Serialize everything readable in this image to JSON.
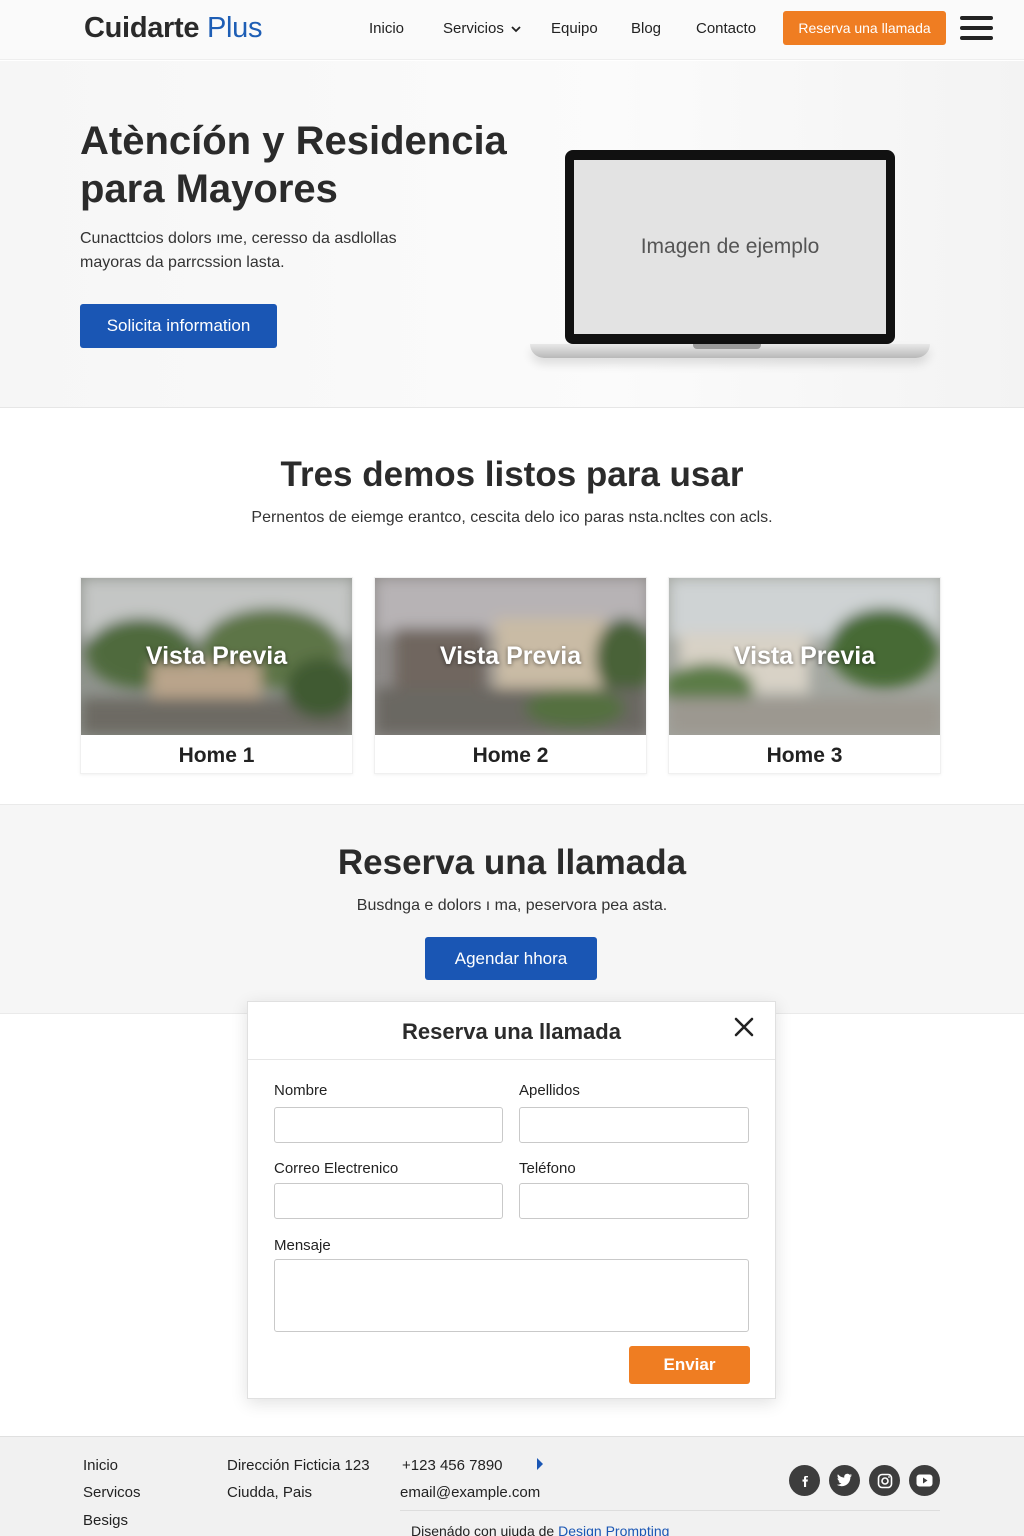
{
  "nav": {
    "logo_main": "Cuidarte",
    "logo_accent": "Plus",
    "links": [
      "Inicio",
      "Servicios",
      "Equipo",
      "Blog",
      "Contacto"
    ],
    "cta": "Reserva una llamada"
  },
  "hero": {
    "title": "Atèncíón y Residencia para Mayores",
    "description": "Cunacttcios dolors ıme, ceresso da asdlollas mayoras da parrcssion lasta.",
    "button": "Solicita information",
    "image_placeholder": "Imagen de ejemplo"
  },
  "demos": {
    "title": "Tres demos listos para usar",
    "subtitle": "Pernentos de eiemge erantco, cescita delo ico paras nsta.ncltes con acls.",
    "cards": [
      {
        "preview": "Vista Previa",
        "name": "Home 1"
      },
      {
        "preview": "Vista Previa",
        "name": "Home 2"
      },
      {
        "preview": "Vista Previa",
        "name": "Home 3"
      }
    ]
  },
  "cta": {
    "title": "Reserva una llamada",
    "subtitle": "Busdnga e dolors ı ma, peservora pea asta.",
    "button": "Agendar hhora"
  },
  "modal": {
    "title": "Reserva una llamada",
    "fields": {
      "first_name": {
        "label": "Nombre",
        "value": ""
      },
      "last_name": {
        "label": "Apellidos",
        "value": ""
      },
      "email": {
        "label": "Correo Electrenico",
        "value": ""
      },
      "phone": {
        "label": "Teléfono",
        "value": ""
      },
      "message": {
        "label": "Mensaje",
        "value": ""
      }
    },
    "submit": "Enviar"
  },
  "footer": {
    "links": [
      "Inicio",
      "Servicos",
      "Besigs"
    ],
    "address_line1": "Dirección Ficticia 123",
    "address_line2": "Ciudda, Pais",
    "phone": "+123 456 7890",
    "email": "email@example.com",
    "credit_prefix": "Disenádo con uiuda de",
    "credit_link": "Design Prompting",
    "social_icons": [
      "facebook-icon",
      "twitter-icon",
      "instagram-icon",
      "youtube-icon"
    ]
  },
  "colors": {
    "brand_blue": "#1a56b4",
    "accent_orange": "#ef7d22",
    "text_dark": "#2b2b2b"
  }
}
